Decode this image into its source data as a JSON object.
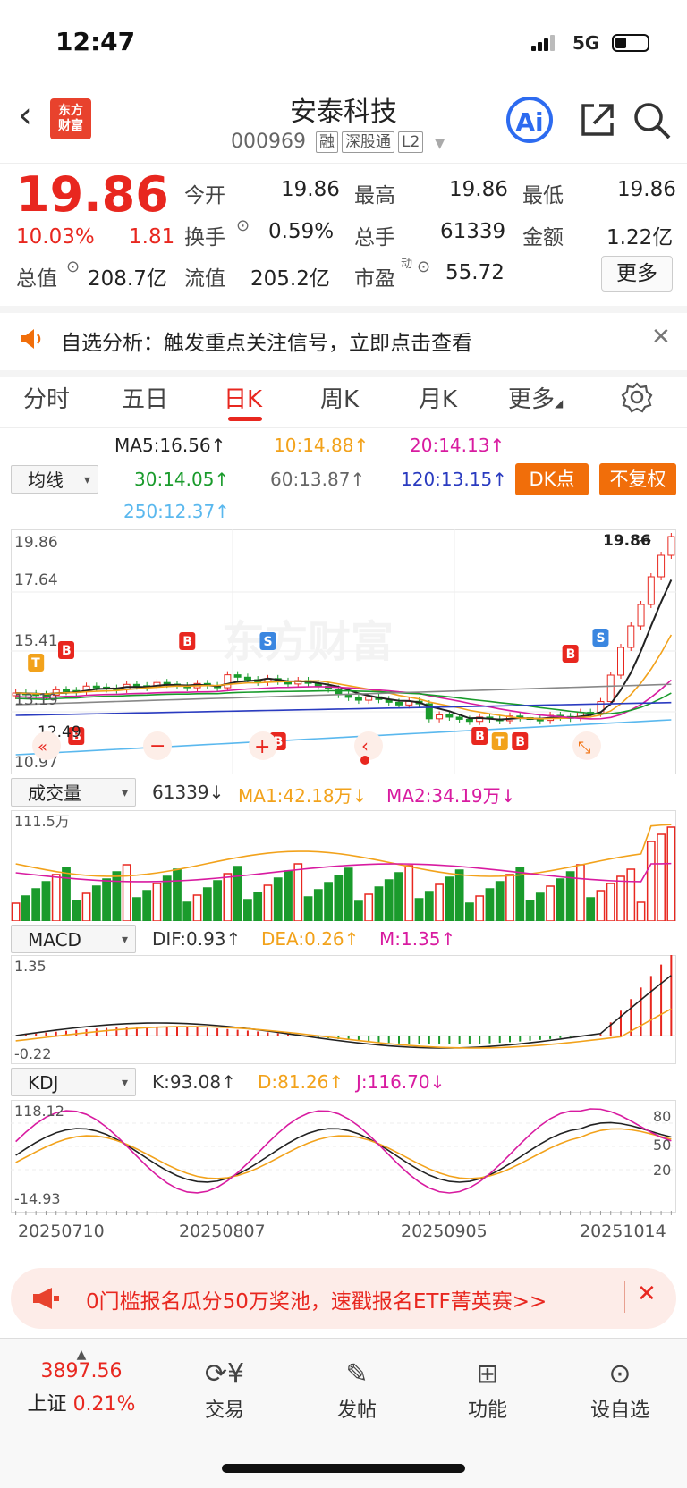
{
  "status_bar": {
    "time": "12:47",
    "network": "5G"
  },
  "header": {
    "title": "安泰科技",
    "code": "000969",
    "tags": [
      "融",
      "深股通",
      "L2"
    ],
    "logo": "东方\n财富"
  },
  "quote": {
    "price": "19.86",
    "change_pct": "10.03%",
    "change": "1.81",
    "fields": [
      {
        "label": "今开",
        "value": "19.86",
        "red": true
      },
      {
        "label": "最高",
        "value": "19.86",
        "red": true
      },
      {
        "label": "最低",
        "value": "19.86",
        "red": true
      },
      {
        "label": "换手",
        "value": "0.59%",
        "red": false
      },
      {
        "label": "总手",
        "value": "61339",
        "red": false
      },
      {
        "label": "金额",
        "value": "1.22亿",
        "red": false
      },
      {
        "label": "总值",
        "value": "208.7亿",
        "red": false
      },
      {
        "label": "流值",
        "value": "205.2亿",
        "red": false
      },
      {
        "label": "市盈",
        "value": "55.72",
        "red": false
      }
    ],
    "more_label": "更多"
  },
  "banner": {
    "text": "自选分析：触发重点关注信号，立即点击查看"
  },
  "tabs": [
    "分时",
    "五日",
    "日K",
    "周K",
    "月K",
    "更多"
  ],
  "active_tab": "日K",
  "ma": {
    "selector": "均线",
    "items": [
      {
        "text": "MA5:16.56↑",
        "color": "#222222"
      },
      {
        "text": "10:14.88↑",
        "color": "#f2a21b"
      },
      {
        "text": "20:14.13↑",
        "color": "#d81ba0"
      },
      {
        "text": "30:14.05↑",
        "color": "#1a9b2c"
      },
      {
        "text": "60:13.87↑",
        "color": "#666666"
      },
      {
        "text": "120:13.15↑",
        "color": "#2a3bc0"
      },
      {
        "text": "250:12.37↑",
        "color": "#5ab8ee"
      }
    ],
    "dk_button": "DK点",
    "fq_button": "不复权"
  },
  "kline": {
    "y_labels": [
      "19.86",
      "17.64",
      "15.41",
      "13.19",
      "10.97"
    ],
    "last_price_label": "19.86",
    "low_label": "12.49",
    "watermark": "东方财富"
  },
  "volume": {
    "selector": "成交量",
    "value": "61339↓",
    "ma1": "MA1:42.18万↓",
    "ma2": "MA2:34.19万↓",
    "max_label": "111.5万"
  },
  "macd": {
    "selector": "MACD",
    "dif": "DIF:0.93↑",
    "dea": "DEA:0.26↑",
    "m": "M:1.35↑",
    "top": "1.35",
    "bottom": "-0.22"
  },
  "kdj": {
    "selector": "KDJ",
    "k": "K:93.08↑",
    "d": "D:81.26↑",
    "j": "J:116.70↓",
    "top": "118.12",
    "bottom": "-14.93",
    "levels": [
      "80",
      "50",
      "20"
    ]
  },
  "dates": [
    "20250710",
    "20250807",
    "20250905",
    "20251014"
  ],
  "bottom_banner": {
    "text": "0门槛报名瓜分50万奖池，速戳报名ETF菁英赛>>"
  },
  "nav": {
    "index_value": "3897.56",
    "index_name": "上证",
    "index_change": "0.21%",
    "items": [
      {
        "label": "交易",
        "icon": "yen-icon"
      },
      {
        "label": "发帖",
        "icon": "edit-icon"
      },
      {
        "label": "功能",
        "icon": "grid-icon"
      },
      {
        "label": "设自选",
        "icon": "more-icon"
      }
    ]
  },
  "colors": {
    "up": "#e8271f",
    "down": "#1a9b2c",
    "accent": "#f16e0a"
  }
}
